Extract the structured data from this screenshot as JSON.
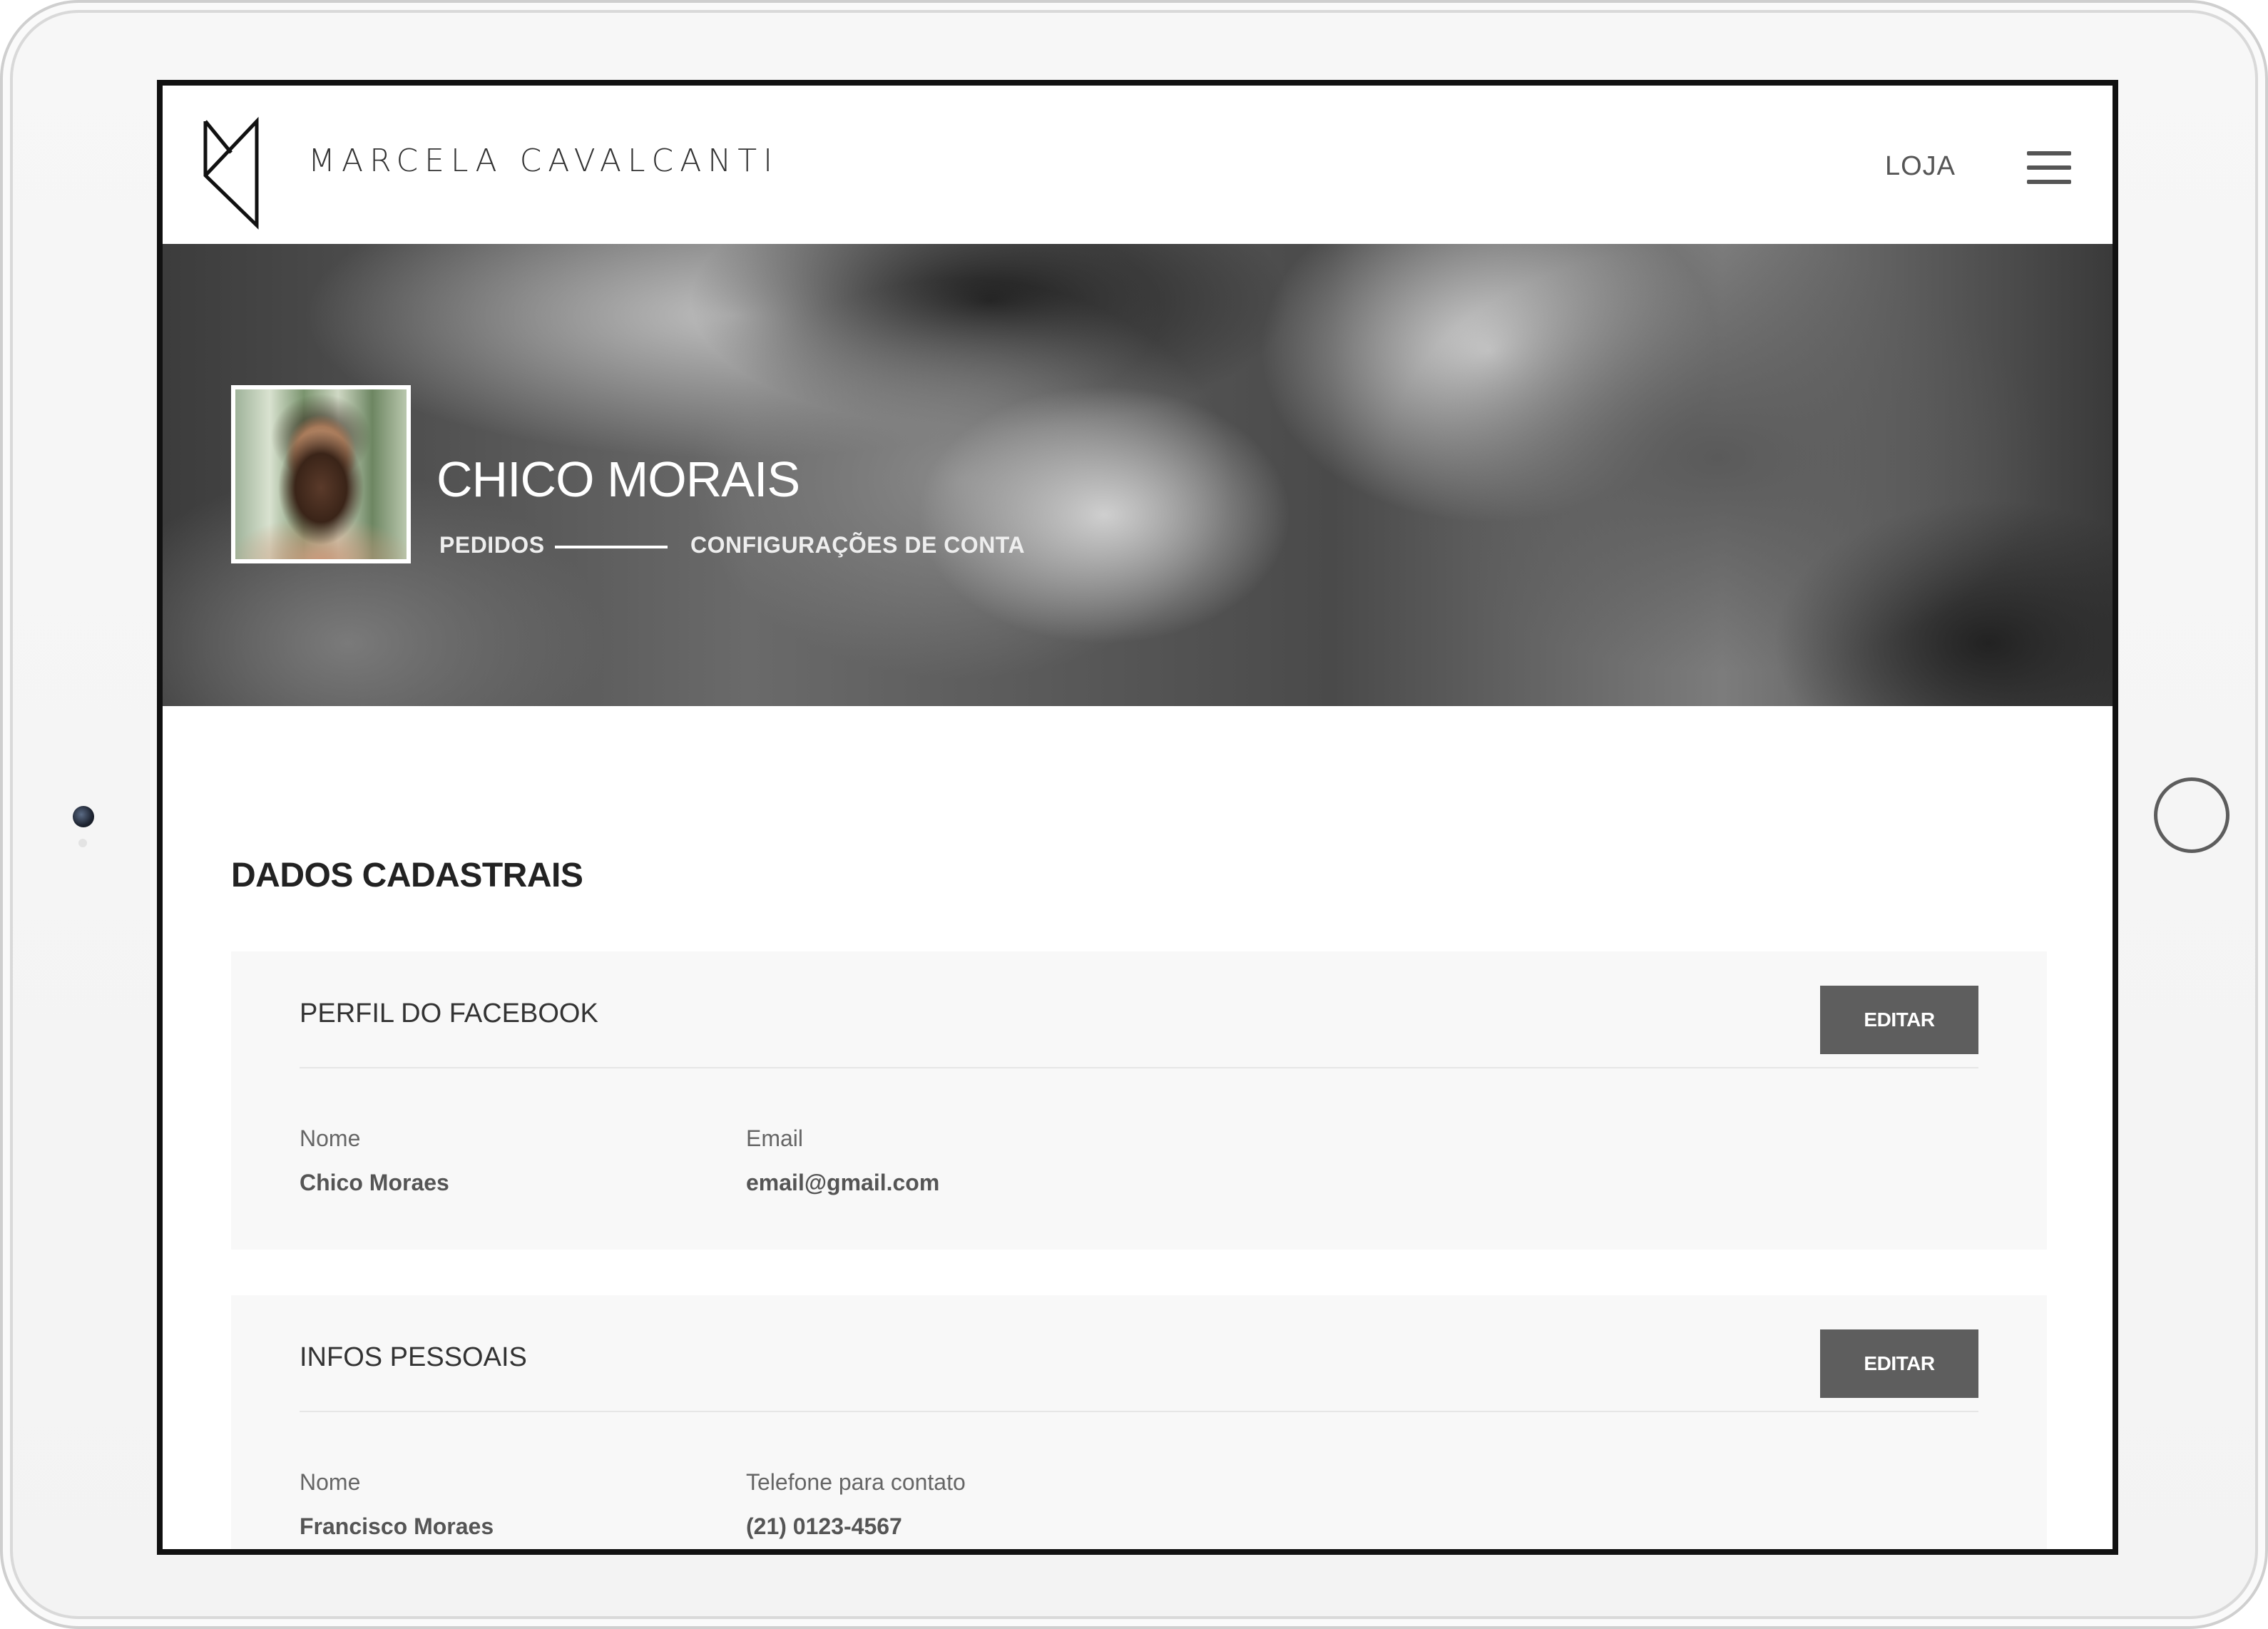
{
  "header": {
    "brand": "MARCELA CAVALCANTI",
    "nav_loja": "LOJA"
  },
  "profile": {
    "name": "CHICO MORAIS",
    "tabs": [
      "PEDIDOS",
      "CONFIGURAÇÕES DE CONTA"
    ]
  },
  "section": {
    "title": "DADOS CADASTRAIS"
  },
  "cards": [
    {
      "title": "PERFIL DO FACEBOOK",
      "edit_label": "EDITAR",
      "fields": [
        {
          "label": "Nome",
          "value": "Chico Moraes"
        },
        {
          "label": "Email",
          "value": "email@gmail.com"
        }
      ]
    },
    {
      "title": "INFOS PESSOAIS",
      "edit_label": "EDITAR",
      "fields": [
        {
          "label": "Nome",
          "value": "Francisco Moraes"
        },
        {
          "label": "Telefone para contato",
          "value": "(21) 0123-4567"
        }
      ]
    }
  ],
  "colors": {
    "button": "#5e5e5e",
    "card_bg": "#f8f8f8",
    "text_dark": "#333333"
  }
}
